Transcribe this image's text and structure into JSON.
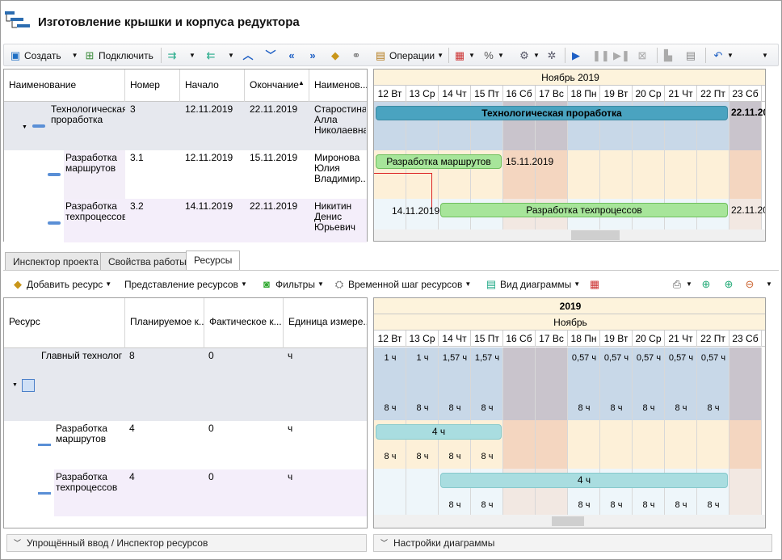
{
  "window": {
    "title": "Изготовление крышки и корпуса редуктора"
  },
  "toolbar": {
    "create": "Создать",
    "connect": "Подключить",
    "operations": "Операции"
  },
  "tasks_grid": {
    "columns": [
      "Наименование",
      "Номер",
      "Начало",
      "Окончание",
      "Наименов..."
    ],
    "rows": [
      {
        "name": "Технологическая\nпроработка",
        "num": "3",
        "start": "12.11.2019",
        "end": "22.11.2019",
        "owner": "Старостина\nАлла\nНиколаевна"
      },
      {
        "name": "Разработка\nмаршрутов",
        "num": "3.1",
        "start": "12.11.2019",
        "end": "15.11.2019",
        "owner": "Миронова\nЮлия\nВладимир..."
      },
      {
        "name": "Разработка\nтехпроцессов",
        "num": "3.2",
        "start": "14.11.2019",
        "end": "22.11.2019",
        "owner": "Никитин\nДенис\nЮрьевич"
      }
    ]
  },
  "gantt_top": {
    "month": "Ноябрь 2019",
    "days": [
      "12 Вт",
      "13 Ср",
      "14 Чт",
      "15 Пт",
      "16 Сб",
      "17 Вс",
      "18 Пн",
      "19 Вт",
      "20 Ср",
      "21 Чт",
      "22 Пт",
      "23 Сб"
    ],
    "bars": {
      "summary": "Технологическая проработка",
      "summary_end": "22.11.20",
      "route": "Разработка маршрутов",
      "route_end": "15.11.2019",
      "proc_start": "14.11.2019",
      "proc": "Разработка техпроцессов",
      "proc_end": "22.11.20"
    }
  },
  "tabs": [
    "Инспектор проекта",
    "Свойства работы",
    "Ресурсы"
  ],
  "res_toolbar": {
    "add": "Добавить ресурс",
    "view": "Представление ресурсов",
    "filters": "Фильтры",
    "step": "Временной шаг ресурсов",
    "chart_view": "Вид диаграммы"
  },
  "res_grid": {
    "columns": [
      "Ресурс",
      "Планируемое к...",
      "Фактическое к...",
      "Единица измере..."
    ],
    "rows": [
      {
        "name": "Главный технолог",
        "plan": "8",
        "fact": "0",
        "unit": "ч"
      },
      {
        "name": "Разработка\nмаршрутов",
        "plan": "4",
        "fact": "0",
        "unit": "ч"
      },
      {
        "name": "Разработка\nтехпроцессов",
        "plan": "4",
        "fact": "0",
        "unit": "ч"
      }
    ]
  },
  "res_gantt": {
    "year": "2019",
    "month": "Ноябрь",
    "days": [
      "12 Вт",
      "13 Ср",
      "14 Чт",
      "15 Пт",
      "16 Сб",
      "17 Вс",
      "18 Пн",
      "19 Вт",
      "20 Ср",
      "21 Чт",
      "22 Пт",
      "23 Сб"
    ],
    "load_top": [
      "1 ч",
      "1 ч",
      "1,57 ч",
      "1,57 ч",
      "",
      "",
      "0,57 ч",
      "0,57 ч",
      "0,57 ч",
      "0,57 ч",
      "0,57 ч",
      ""
    ],
    "cap_row1": [
      "8 ч",
      "8 ч",
      "8 ч",
      "8 ч",
      "",
      "",
      "8 ч",
      "8 ч",
      "8 ч",
      "8 ч",
      "8 ч",
      ""
    ],
    "bar_route": "4 ч",
    "cap_row2": [
      "8 ч",
      "8 ч",
      "8 ч",
      "8 ч",
      "",
      "",
      "",
      "",
      "",
      "",
      "",
      ""
    ],
    "bar_proc": "4 ч",
    "cap_row3": [
      "",
      "",
      "8 ч",
      "8 ч",
      "",
      "",
      "8 ч",
      "8 ч",
      "8 ч",
      "8 ч",
      "8 ч",
      ""
    ]
  },
  "footer": {
    "left": "Упрощённый ввод / Инспектор ресурсов",
    "right": "Настройки диаграммы"
  }
}
